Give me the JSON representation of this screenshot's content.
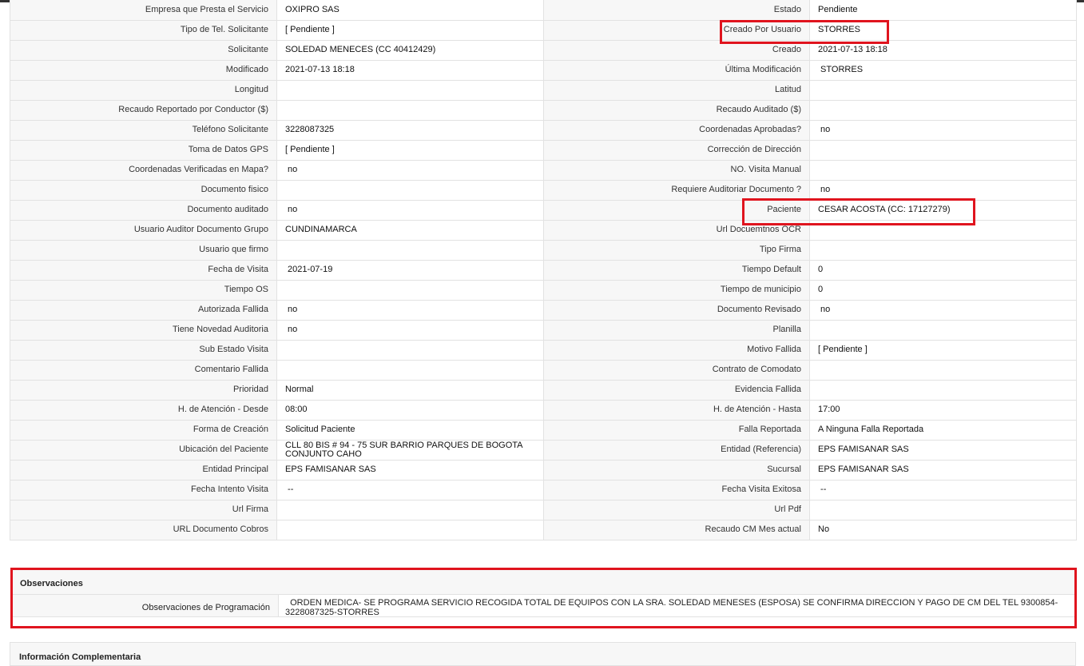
{
  "rows": [
    {
      "l1": "Empresa que Presta el Servicio",
      "v1": "OXIPRO SAS",
      "l2": "Estado",
      "v2": "Pendiente"
    },
    {
      "l1": "Tipo de Tel. Solicitante",
      "v1": "[ Pendiente ]",
      "l2": "Creado Por Usuario",
      "v2": "STORRES"
    },
    {
      "l1": "Solicitante",
      "v1": "SOLEDAD MENECES (CC 40412429)",
      "l2": "Creado",
      "v2": "2021-07-13 18:18"
    },
    {
      "l1": "Modificado",
      "v1": "2021-07-13 18:18",
      "l2": "Última Modificación",
      "v2": " STORRES"
    },
    {
      "l1": "Longitud",
      "v1": "",
      "l2": "Latitud",
      "v2": ""
    },
    {
      "l1": "Recaudo Reportado por Conductor ($)",
      "v1": "",
      "l2": "Recaudo Auditado ($)",
      "v2": ""
    },
    {
      "l1": "Teléfono Solicitante",
      "v1": "3228087325",
      "l2": "Coordenadas Aprobadas?",
      "v2": " no"
    },
    {
      "l1": "Toma de Datos GPS",
      "v1": "[ Pendiente ]",
      "l2": "Corrección de Dirección",
      "v2": ""
    },
    {
      "l1": "Coordenadas Verificadas en Mapa?",
      "v1": " no",
      "l2": "NO. Visita Manual",
      "v2": ""
    },
    {
      "l1": "Documento fisico",
      "v1": "",
      "l2": "Requiere Auditoriar Documento ?",
      "v2": " no"
    },
    {
      "l1": "Documento auditado",
      "v1": " no",
      "l2": "Paciente",
      "v2": "CESAR ACOSTA (CC: 17127279)"
    },
    {
      "l1": "Usuario Auditor Documento Grupo",
      "v1": "CUNDINAMARCA",
      "l2": "Url Docuemtnos OCR",
      "v2": ""
    },
    {
      "l1": "Usuario que firmo",
      "v1": "",
      "l2": "Tipo Firma",
      "v2": ""
    },
    {
      "l1": "Fecha de Visita",
      "v1": " 2021-07-19",
      "l2": "Tiempo Default",
      "v2": "0"
    },
    {
      "l1": "Tiempo OS",
      "v1": "",
      "l2": "Tiempo de municipio",
      "v2": "0"
    },
    {
      "l1": "Autorizada Fallida",
      "v1": " no",
      "l2": "Documento Revisado",
      "v2": " no"
    },
    {
      "l1": "Tiene Novedad Auditoria",
      "v1": " no",
      "l2": "Planilla",
      "v2": ""
    },
    {
      "l1": "Sub Estado Visita",
      "v1": "",
      "l2": "Motivo Fallida",
      "v2": "[ Pendiente ]"
    },
    {
      "l1": "Comentario Fallida",
      "v1": "",
      "l2": "Contrato de Comodato",
      "v2": ""
    },
    {
      "l1": "Prioridad",
      "v1": "Normal",
      "l2": "Evidencia Fallida",
      "v2": ""
    },
    {
      "l1": "H. de Atención - Desde",
      "v1": "08:00",
      "l2": "H. de Atención - Hasta",
      "v2": "17:00"
    },
    {
      "l1": "Forma de Creación",
      "v1": "Solicitud Paciente",
      "l2": "Falla Reportada",
      "v2": "A Ninguna Falla Reportada"
    },
    {
      "l1": "Ubicación del Paciente",
      "v1": "CLL 80 BIS # 94 - 75 SUR BARRIO PARQUES DE BOGOTA CONJUNTO CAHO",
      "l2": "Entidad (Referencia)",
      "v2": "EPS FAMISANAR SAS"
    },
    {
      "l1": "Entidad Principal",
      "v1": "EPS FAMISANAR SAS",
      "l2": "Sucursal",
      "v2": "EPS FAMISANAR SAS"
    },
    {
      "l1": "Fecha Intento Visita",
      "v1": " --",
      "l2": "Fecha Visita Exitosa",
      "v2": " --"
    },
    {
      "l1": "Url Firma",
      "v1": "",
      "l2": "Url Pdf",
      "v2": ""
    },
    {
      "l1": "URL Documento Cobros",
      "v1": "",
      "l2": "Recaudo CM Mes actual",
      "v2": "No"
    }
  ],
  "observaciones": {
    "title": "Observaciones",
    "label": "Observaciones de Programación",
    "value": "  ORDEN MEDICA- SE PROGRAMA SERVICIO RECOGIDA TOTAL DE EQUIPOS CON LA SRA. SOLEDAD MENESES (ESPOSA) SE CONFIRMA DIRECCION Y PAGO DE CM DEL TEL 9300854-3228087325-STORRES"
  },
  "info_complementaria": {
    "title": "Información Complementaria"
  },
  "colors": {
    "highlight": "#e0141e",
    "label_bg": "#f7f7f7",
    "border": "#e2e2e2"
  }
}
